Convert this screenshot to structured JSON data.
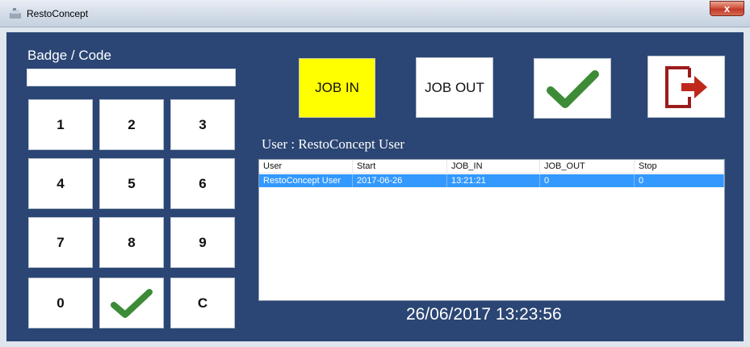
{
  "window": {
    "title": "RestoConcept",
    "close_glyph": "x"
  },
  "badge": {
    "label": "Badge / Code",
    "value": ""
  },
  "keypad": {
    "keys": [
      "1",
      "2",
      "3",
      "4",
      "5",
      "6",
      "7",
      "8",
      "9",
      "0"
    ],
    "clear_label": "C",
    "confirm_icon": "checkmark-icon"
  },
  "actions": {
    "job_in_label": "JOB IN",
    "job_out_label": "JOB OUT",
    "confirm_icon": "checkmark-icon",
    "exit_icon": "exit-door-icon"
  },
  "user_line": "User : RestoConcept User",
  "table": {
    "columns": [
      "User",
      "Start",
      "JOB_IN",
      "JOB_OUT",
      "Stop"
    ],
    "rows": [
      [
        "RestoConcept User",
        "2017-06-26",
        "13:21:21",
        "0",
        "0"
      ]
    ]
  },
  "clock": "26/06/2017 13:23:56",
  "colors": {
    "background": "#2b4674",
    "job_in_active": "#ffff00",
    "selection": "#3399ff",
    "check_green": "#3d8b37",
    "exit_red": "#9b1c1c"
  }
}
